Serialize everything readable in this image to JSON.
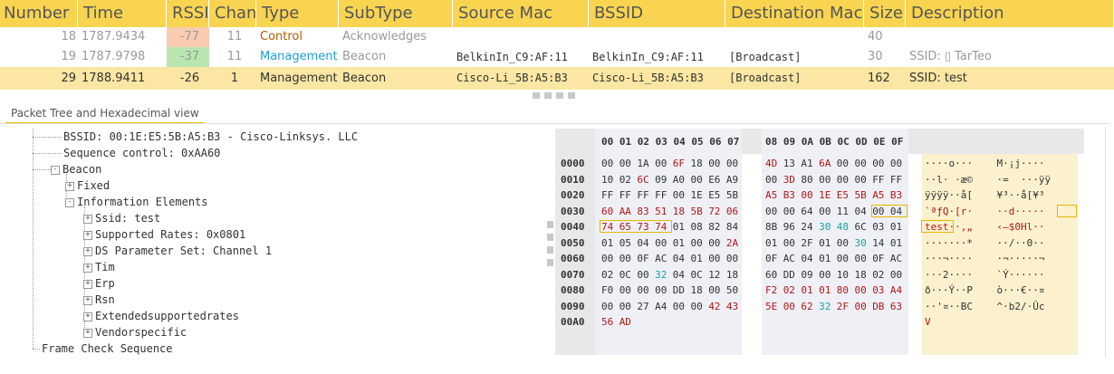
{
  "columns": [
    "Number",
    "Time",
    "RSSI",
    "Chan",
    "Type",
    "SubType",
    "Source Mac",
    "BSSID",
    "Destination Mac",
    "Size",
    "Description"
  ],
  "packets": [
    {
      "num": "18",
      "time": "1787.9434",
      "rssi": "-77",
      "rssi_bg": "#f9cbb0",
      "chan": "11",
      "type": "Control",
      "subtype": "Acknowledges",
      "src": "",
      "bssid": "",
      "dst": "",
      "size": "40",
      "desc": ""
    },
    {
      "num": "19",
      "time": "1787.9798",
      "rssi": "-37",
      "rssi_bg": "#b9e6b0",
      "chan": "11",
      "type": "Management",
      "subtype": "Beacon",
      "src": "BelkinIn_C9:AF:11",
      "bssid": "BelkinIn_C9:AF:11",
      "dst": "[Broadcast]",
      "size": "30",
      "desc": "SSID: ▯ TarTeo"
    },
    {
      "num": "29",
      "time": "1788.9411",
      "rssi": "-26",
      "rssi_bg": "",
      "chan": "1",
      "type": "Management",
      "subtype": "Beacon",
      "src": "Cisco-Li_5B:A5:B3",
      "bssid": "Cisco-Li_5B:A5:B3",
      "dst": "[Broadcast]",
      "size": "162",
      "desc": "SSID: test"
    }
  ],
  "tree_tab": "Packet Tree and Hexadecimal view",
  "tree": [
    {
      "text": "BSSID: 00:1E:E5:5B:A5:B3 - Cisco-Linksys. LLC",
      "indent": 0,
      "exp": ""
    },
    {
      "text": "Sequence control: 0xAA60",
      "indent": 0,
      "exp": ""
    },
    {
      "text": "Beacon",
      "indent": 0,
      "exp": "-"
    },
    {
      "text": "Fixed",
      "indent": 1,
      "exp": "+"
    },
    {
      "text": "Information Elements",
      "indent": 1,
      "exp": "-"
    },
    {
      "text": "Ssid: test",
      "indent": 2,
      "exp": "+"
    },
    {
      "text": "Supported Rates: 0x0801",
      "indent": 2,
      "exp": "+"
    },
    {
      "text": "DS Parameter Set: Channel 1",
      "indent": 2,
      "exp": "+"
    },
    {
      "text": "Tim",
      "indent": 2,
      "exp": "+"
    },
    {
      "text": "Erp",
      "indent": 2,
      "exp": "+"
    },
    {
      "text": "Rsn",
      "indent": 2,
      "exp": "+"
    },
    {
      "text": "Extendedsupportedrates",
      "indent": 2,
      "exp": "+"
    },
    {
      "text": "Vendorspecific",
      "indent": 2,
      "exp": "+"
    },
    {
      "text": "Frame Check Sequence",
      "indent": -1,
      "exp": ""
    }
  ],
  "hex": {
    "header1": "00 01 02 03 04 05 06 07",
    "header2": "08 09 0A 0B 0C 0D 0E 0F",
    "rows": [
      {
        "off": "0000",
        "b1": [
          "00",
          "00",
          "1A",
          "00",
          "6F",
          "18",
          "00",
          "00"
        ],
        "b2": [
          "4D",
          "13",
          "A1",
          "6A",
          "00",
          "00",
          "00",
          "00"
        ],
        "ascii": "····o···    M·¡j····"
      },
      {
        "off": "0010",
        "b1": [
          "10",
          "02",
          "6C",
          "09",
          "A0",
          "00",
          "E6",
          "A9"
        ],
        "b2": [
          "00",
          "3D",
          "80",
          "00",
          "00",
          "00",
          "FF",
          "FF"
        ],
        "ascii": "··l· ·æ©    ·=  ···ÿÿ"
      },
      {
        "off": "0020",
        "b1": [
          "FF",
          "FF",
          "FF",
          "FF",
          "00",
          "1E",
          "E5",
          "5B"
        ],
        "b2": [
          "A5",
          "B3",
          "00",
          "1E",
          "E5",
          "5B",
          "A5",
          "B3"
        ],
        "ascii": "ÿÿÿÿ··å[    ¥³··å[¥³"
      },
      {
        "off": "0030",
        "b1": [
          "60",
          "AA",
          "83",
          "51",
          "18",
          "5B",
          "72",
          "06"
        ],
        "b2": [
          "00",
          "00",
          "64",
          "00",
          "11",
          "04",
          "00",
          "04"
        ],
        "ascii": "`ªƒQ·[r·    ··d·····"
      },
      {
        "off": "0040",
        "b1": [
          "74",
          "65",
          "73",
          "74",
          "01",
          "08",
          "82",
          "84"
        ],
        "b2": [
          "8B",
          "96",
          "24",
          "30",
          "48",
          "6C",
          "03",
          "01"
        ],
        "ascii": "test··‚„    ‹–$0Hl··"
      },
      {
        "off": "0050",
        "b1": [
          "01",
          "05",
          "04",
          "00",
          "01",
          "00",
          "00",
          "2A"
        ],
        "b2": [
          "01",
          "00",
          "2F",
          "01",
          "00",
          "30",
          "14",
          "01"
        ],
        "ascii": "·······*    ··/··0··"
      },
      {
        "off": "0060",
        "b1": [
          "00",
          "00",
          "0F",
          "AC",
          "04",
          "01",
          "00",
          "00"
        ],
        "b2": [
          "0F",
          "AC",
          "04",
          "01",
          "00",
          "00",
          "0F",
          "AC"
        ],
        "ascii": "···¬····    ·¬·····¬"
      },
      {
        "off": "0070",
        "b1": [
          "02",
          "0C",
          "00",
          "32",
          "04",
          "0C",
          "12",
          "18"
        ],
        "b2": [
          "60",
          "DD",
          "09",
          "00",
          "10",
          "18",
          "02",
          "00"
        ],
        "ascii": "···2····    `Ý······"
      },
      {
        "off": "0080",
        "b1": [
          "F0",
          "00",
          "00",
          "00",
          "DD",
          "18",
          "00",
          "50"
        ],
        "b2": [
          "F2",
          "02",
          "01",
          "01",
          "80",
          "00",
          "03",
          "A4"
        ],
        "ascii": "ð···Ý··P    ò···€··¤"
      },
      {
        "off": "0090",
        "b1": [
          "00",
          "00",
          "27",
          "A4",
          "00",
          "00",
          "42",
          "43"
        ],
        "b2": [
          "5E",
          "00",
          "62",
          "32",
          "2F",
          "00",
          "DB",
          "63"
        ],
        "ascii": "··'¤··BC    ^·b2/·Ûc"
      },
      {
        "off": "00A0",
        "b1": [
          "56",
          "AD"
        ],
        "b2": [],
        "ascii": "V­"
      }
    ]
  },
  "colors": {
    "header_bg": "#f8d451",
    "selected_bg": "#fbe7a3",
    "control": "#b35c00",
    "management": "#1ba1d6"
  }
}
